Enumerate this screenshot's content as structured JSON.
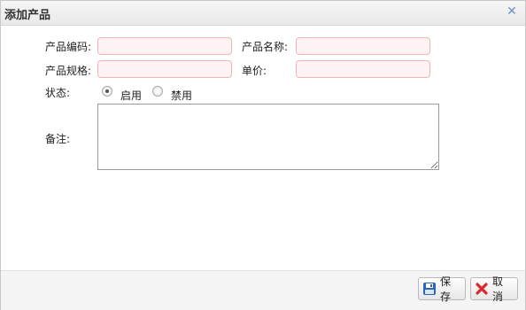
{
  "dialog": {
    "title": "添加产品",
    "close_icon": "close-icon"
  },
  "form": {
    "code_label": "产品编码:",
    "name_label": "产品名称:",
    "spec_label": "产品规格:",
    "price_label": "单价:",
    "status_label": "状态:",
    "status_options": [
      {
        "label": "启用",
        "selected": true
      },
      {
        "label": "禁用",
        "selected": false
      }
    ],
    "remark_label": "备注:",
    "values": {
      "code": "",
      "name": "",
      "spec": "",
      "price": "",
      "remark": ""
    }
  },
  "footer": {
    "save_label": "保存",
    "cancel_label": "取消",
    "save_icon": "save-icon",
    "cancel_icon": "cancel-icon"
  },
  "colors": {
    "required_bg": "#fff3f3",
    "required_border": "#f2b4b4",
    "close_icon": "#6d8fc7",
    "cancel_icon": "#e0262b",
    "save_icon": "#2a66b6"
  }
}
